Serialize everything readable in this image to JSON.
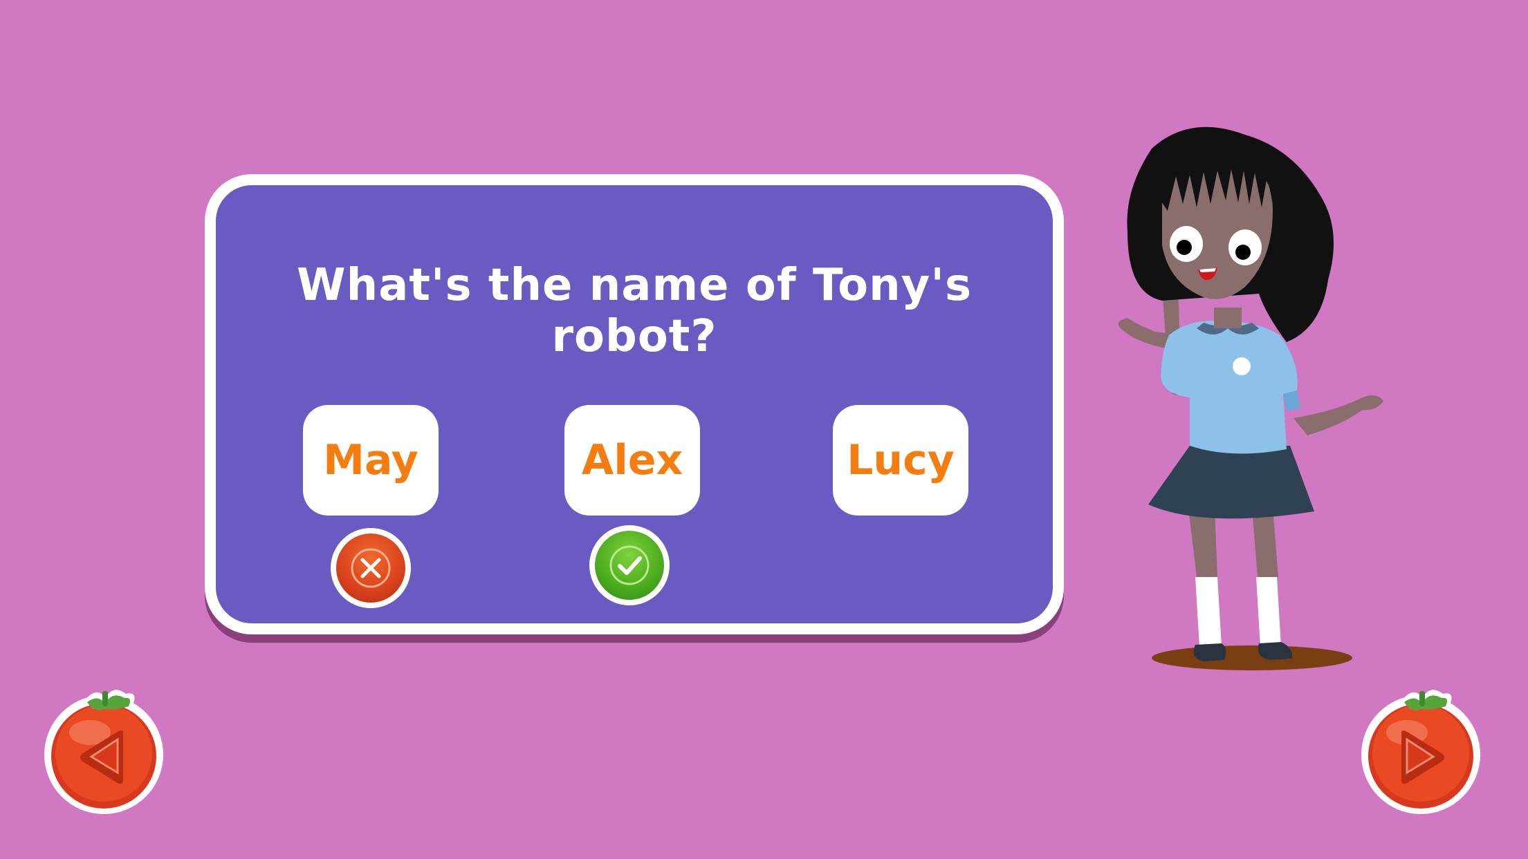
{
  "quiz": {
    "question": "What's the name of Tony's robot?",
    "options": [
      {
        "label": "May",
        "status": "wrong"
      },
      {
        "label": "Alex",
        "status": "correct"
      },
      {
        "label": "Lucy",
        "status": "unanswered"
      }
    ]
  },
  "icons": {
    "wrong": "x-mark-icon",
    "correct": "checkmark-icon",
    "previous": "tomato-previous-icon",
    "next": "tomato-next-icon"
  },
  "colors": {
    "background": "#d079c2",
    "card": "#685bc2",
    "option_text": "#f57d0f",
    "wrong": "#d8411c",
    "correct": "#4aaa1e"
  }
}
